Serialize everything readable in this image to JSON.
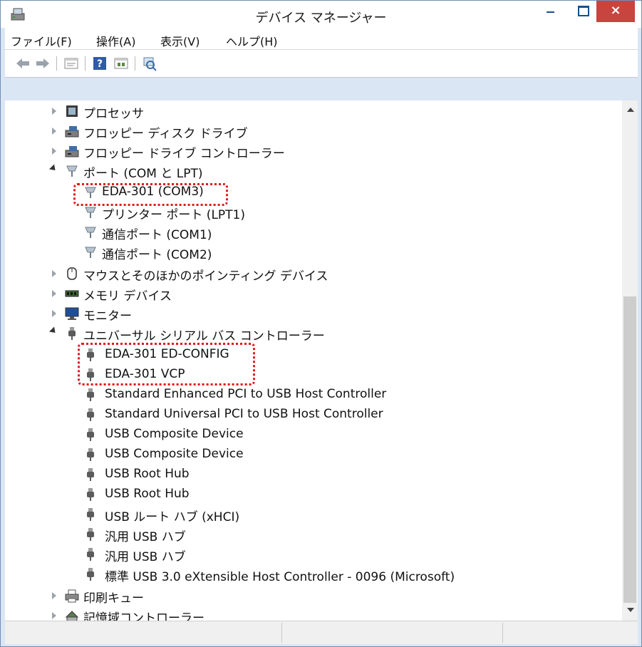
{
  "window": {
    "title": "デバイス マネージャー",
    "close_glyph": "×"
  },
  "menu": [
    "ファイル(F)",
    "操作(A)",
    "表示(V)",
    "ヘルプ(H)"
  ],
  "toolbar_icons": [
    "back-arrow-icon",
    "forward-arrow-icon",
    "properties-icon",
    "help-icon",
    "update-driver-icon",
    "scan-hardware-icon"
  ],
  "tree": {
    "processor": "プロセッサ",
    "floppy_drive": "フロッピー ディスク ドライブ",
    "floppy_controller": "フロッピー ドライブ コントローラー",
    "ports": "ポート (COM と LPT)",
    "port_children": [
      "EDA-301 (COM3)",
      "プリンター ポート (LPT1)",
      "通信ポート (COM1)",
      "通信ポート (COM2)"
    ],
    "mouse": "マウスとそのほかのポインティング デバイス",
    "memory": "メモリ デバイス",
    "monitor": "モニター",
    "usb": "ユニバーサル シリアル バス コントローラー",
    "usb_children": [
      "EDA-301 ED-CONFIG",
      "EDA-301 VCP",
      "Standard Enhanced PCI to USB Host Controller",
      "Standard Universal PCI to USB Host Controller",
      "USB Composite Device",
      "USB Composite Device",
      "USB Root Hub",
      "USB Root Hub",
      "USB ルート ハブ (xHCI)",
      "汎用 USB ハブ",
      "汎用 USB ハブ",
      "標準 USB 3.0 eXtensible Host Controller - 0096 (Microsoft)"
    ],
    "print_queue": "印刷キュー",
    "storage": "記憶域コントローラー"
  },
  "colors": {
    "highlight": "#e0191b",
    "close_button": "#c7443f",
    "frame": "#dbe6f4"
  }
}
